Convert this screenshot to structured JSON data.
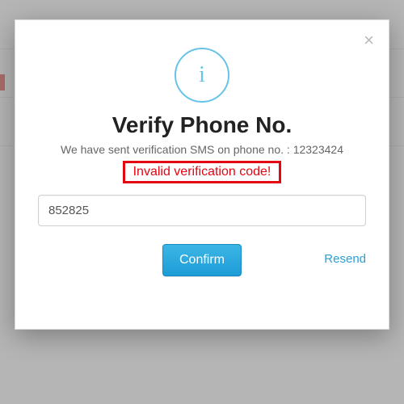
{
  "modal": {
    "icon_letter": "i",
    "title": "Verify Phone No.",
    "subtitle_prefix": "We have sent verification SMS on phone no. : ",
    "phone_number": "12323424",
    "error_message": "Invalid verification code!",
    "code_value": "852825",
    "confirm_label": "Confirm",
    "resend_label": "Resend",
    "close_symbol": "×"
  }
}
